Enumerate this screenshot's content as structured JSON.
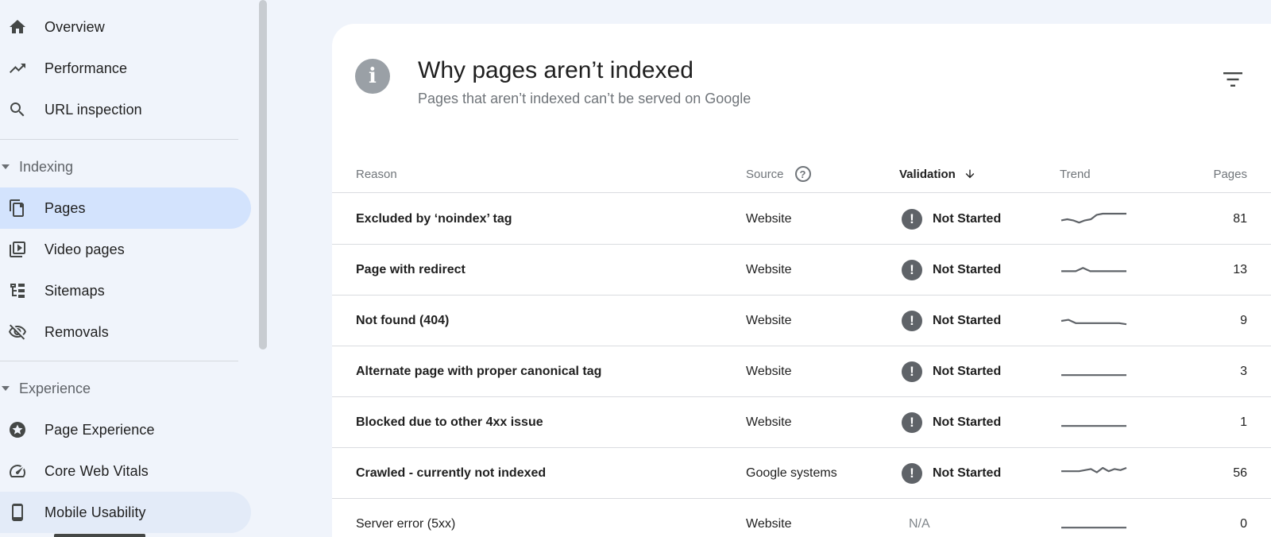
{
  "sidebar": {
    "top_items": [
      {
        "label": "Overview",
        "icon": "home-icon"
      },
      {
        "label": "Performance",
        "icon": "trending-up-icon"
      },
      {
        "label": "URL inspection",
        "icon": "search-icon"
      }
    ],
    "indexing": {
      "heading": "Indexing",
      "items": [
        {
          "label": "Pages",
          "icon": "pages-icon",
          "selected": true
        },
        {
          "label": "Video pages",
          "icon": "video-pages-icon"
        },
        {
          "label": "Sitemaps",
          "icon": "sitemap-icon"
        },
        {
          "label": "Removals",
          "icon": "visibility-off-icon"
        }
      ]
    },
    "experience": {
      "heading": "Experience",
      "items": [
        {
          "label": "Page Experience",
          "icon": "page-experience-icon"
        },
        {
          "label": "Core Web Vitals",
          "icon": "speedometer-icon"
        },
        {
          "label": "Mobile Usability",
          "icon": "smartphone-icon"
        }
      ]
    }
  },
  "card": {
    "title": "Why pages aren’t indexed",
    "subtitle": "Pages that aren’t indexed can’t be served on Google",
    "info_icon_glyph": "i"
  },
  "table": {
    "columns": {
      "reason": "Reason",
      "source": "Source",
      "source_help": "?",
      "validation": "Validation",
      "trend": "Trend",
      "pages": "Pages"
    },
    "rows": [
      {
        "reason": "Excluded by ‘noindex’ tag",
        "source": "Website",
        "validation": "Not Started",
        "pages": "81",
        "trend": [
          0.45,
          0.5,
          0.45,
          0.35,
          0.45,
          0.5,
          0.7,
          0.75,
          0.75,
          0.75,
          0.75,
          0.75
        ]
      },
      {
        "reason": "Page with redirect",
        "source": "Website",
        "validation": "Not Started",
        "pages": "13",
        "trend": [
          0.45,
          0.45,
          0.45,
          0.6,
          0.45,
          0.45,
          0.45,
          0.45,
          0.45,
          0.45
        ]
      },
      {
        "reason": "Not found (404)",
        "source": "Website",
        "validation": "Not Started",
        "pages": "9",
        "trend": [
          0.5,
          0.55,
          0.4,
          0.4,
          0.4,
          0.4,
          0.4,
          0.4,
          0.4,
          0.35
        ]
      },
      {
        "reason": "Alternate page with proper canonical tag",
        "source": "Website",
        "validation": "Not Started",
        "pages": "3",
        "trend": [
          0.35,
          0.35,
          0.35,
          0.35,
          0.35,
          0.35,
          0.35,
          0.35
        ]
      },
      {
        "reason": "Blocked due to other 4xx issue",
        "source": "Website",
        "validation": "Not Started",
        "pages": "1",
        "trend": [
          0.35,
          0.35,
          0.35,
          0.35,
          0.35,
          0.35,
          0.35,
          0.35
        ]
      },
      {
        "reason": "Crawled - currently not indexed",
        "source": "Google systems",
        "validation": "Not Started",
        "pages": "56",
        "trend": [
          0.6,
          0.6,
          0.6,
          0.6,
          0.65,
          0.7,
          0.55,
          0.75,
          0.6,
          0.7,
          0.65,
          0.75
        ]
      },
      {
        "reason": "Server error (5xx)",
        "source": "Website",
        "validation": "N/A",
        "pages": "0",
        "trend": [
          0.35,
          0.35,
          0.35,
          0.35,
          0.35,
          0.35,
          0.35,
          0.35
        ]
      }
    ]
  },
  "colors": {
    "background": "#f0f4fb",
    "selected_nav": "#d3e3fd",
    "status_icon": "#5f6368",
    "sparkline": "#5f6368"
  }
}
